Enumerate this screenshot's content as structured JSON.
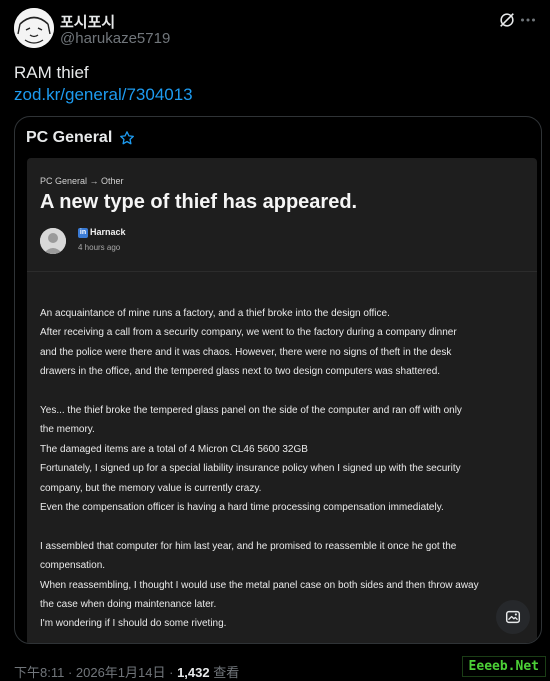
{
  "author": {
    "display_name": "포시포시",
    "handle": "@harukaze5719"
  },
  "tweet": {
    "text": "RAM thief",
    "link": "zod.kr/general/7304013"
  },
  "card": {
    "title": "PC General",
    "article": {
      "breadcrumb": "PC General → Other",
      "headline": "A new type of thief has appeared.",
      "author_badge": "in",
      "author_name": "Harnack",
      "time": "4 hours ago",
      "paragraphs": [
        [
          "An acquaintance of mine runs a factory, and a thief broke into the design office.",
          "After receiving a call from a security company, we went to the factory during a company dinner",
          "and the police were there and it was chaos. However, there were no signs of theft in the desk",
          "drawers in the office, and the tempered glass next to two design computers was shattered."
        ],
        [
          "Yes... the thief broke the tempered glass panel on the side of the computer and ran off with only",
          "the memory.",
          "The damaged items are a total of 4 Micron CL46 5600 32GB",
          "Fortunately, I signed up for a special liability insurance policy when I signed up with the security",
          "company, but the memory value is currently crazy.",
          "Even the compensation officer is having a hard time processing compensation immediately."
        ],
        [
          "I assembled that computer for him last year, and he promised to reassemble it once he got the",
          "compensation.",
          "When reassembling, I thought I would use the metal panel case on both sides and then throw away",
          "the case when doing maintenance later.",
          "I'm wondering if I should do some riveting."
        ]
      ]
    }
  },
  "meta": {
    "timestamp": "下午8:11 · 2026年1月14日 · ",
    "views": "1,432",
    "views_label": " 查看"
  },
  "watermark": "Eeeeb.Net",
  "colors": {
    "link": "#1d9bf0",
    "muted": "#71767b",
    "background": "#000000",
    "article_bg": "#1e1e1e",
    "watermark": "#4cd137"
  },
  "icons": [
    "grok-icon",
    "more-icon",
    "star-icon",
    "image-description-icon"
  ]
}
